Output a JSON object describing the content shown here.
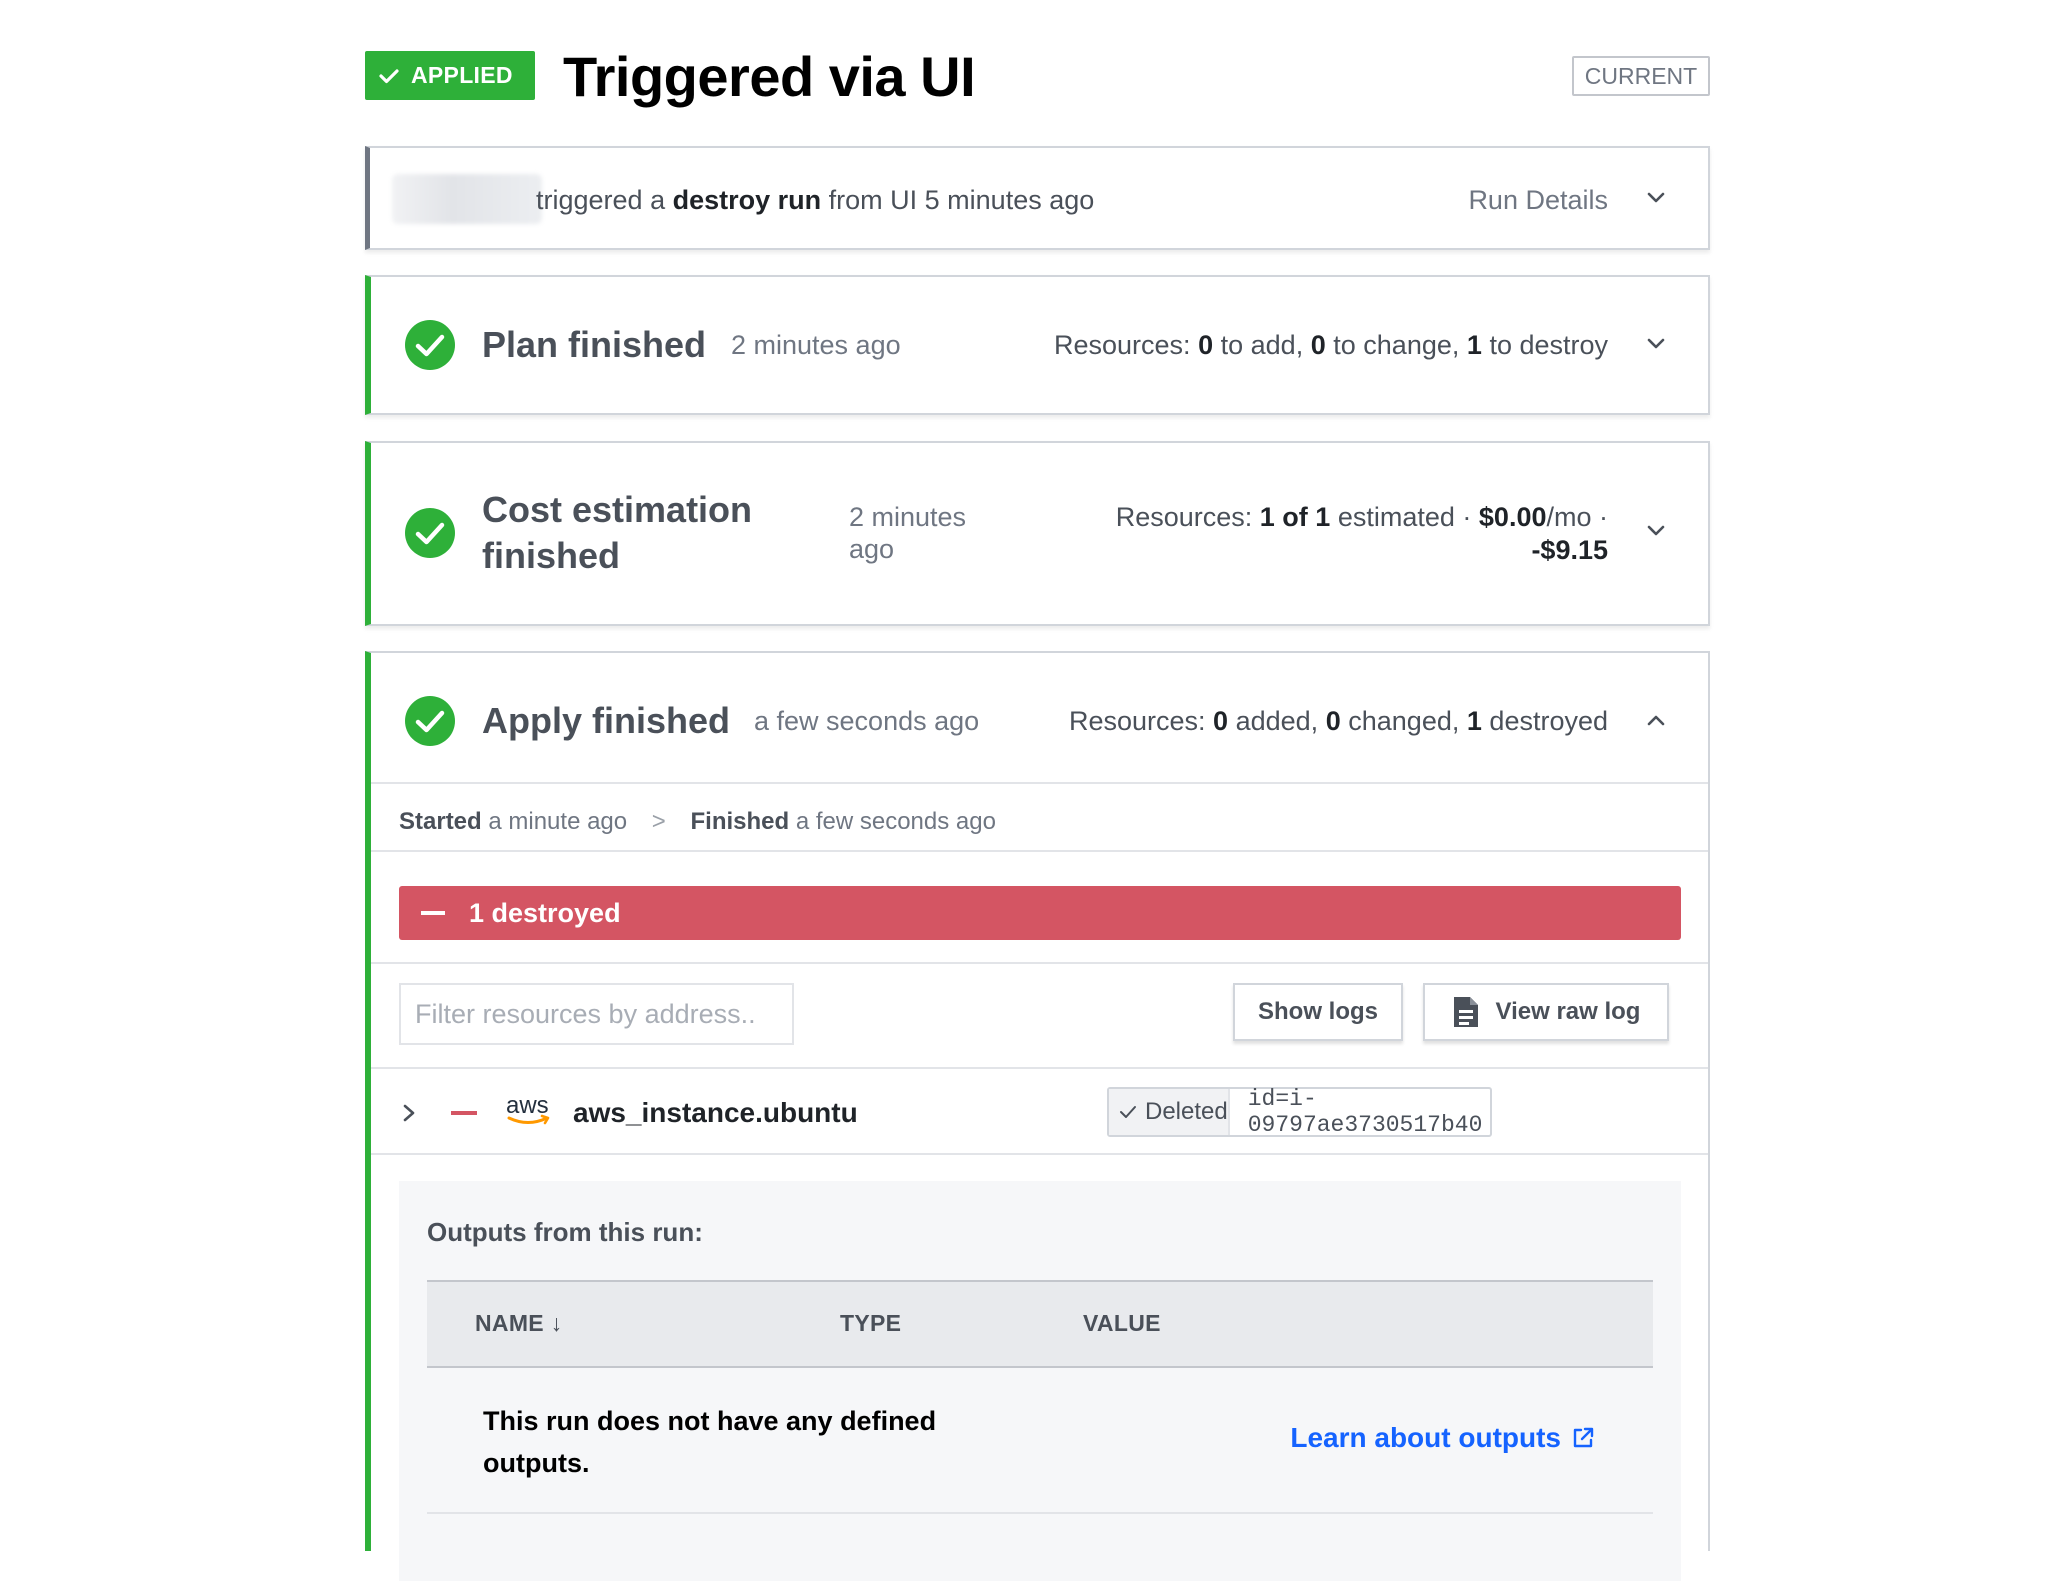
{
  "header": {
    "status_badge": "APPLIED",
    "title": "Triggered via UI",
    "current_tag": "CURRENT"
  },
  "trigger": {
    "text_pre": "triggered a",
    "run_type": "destroy run",
    "text_post": "from UI 5 minutes ago",
    "details_label": "Run Details"
  },
  "plan": {
    "title": "Plan finished",
    "time": "2 minutes ago",
    "res_label": "Resources:",
    "add_count": "0",
    "add_label": "to add,",
    "change_count": "0",
    "change_label": "to change,",
    "destroy_count": "1",
    "destroy_label": "to destroy"
  },
  "cost": {
    "title_line1": "Cost estimation",
    "title_line2": "finished",
    "time_line1": "2 minutes",
    "time_line2": "ago",
    "res_label": "Resources:",
    "estimated_count": "1 of 1",
    "estimated_label": "estimated ·",
    "monthly": "$0.00",
    "monthly_unit": "/mo ·",
    "delta": "-$9.15"
  },
  "apply": {
    "title": "Apply finished",
    "time": "a few seconds ago",
    "res_label": "Resources:",
    "added_count": "0",
    "added_label": "added,",
    "changed_count": "0",
    "changed_label": "changed,",
    "destroyed_count": "1",
    "destroyed_label": "destroyed",
    "started_label": "Started",
    "started_time": "a minute ago",
    "timeline_sep": ">",
    "finished_label": "Finished",
    "finished_time": "a few seconds ago",
    "destroyed_bar": "1 destroyed",
    "filter_placeholder": "Filter resources by address..",
    "show_logs": "Show logs",
    "view_raw_log": "View raw log",
    "resource": {
      "provider_logo": "aws",
      "name": "aws_instance.ubuntu",
      "status": "Deleted",
      "id": "id=i-09797ae3730517b40"
    },
    "outputs": {
      "title": "Outputs from this run:",
      "columns": [
        "NAME ↓",
        "TYPE",
        "VALUE"
      ],
      "empty_text": "This run does not have any defined outputs.",
      "learn_link": "Learn about outputs"
    }
  },
  "colors": {
    "success": "#2eb039",
    "danger": "#d45563",
    "link": "#1563ff",
    "aws_orange": "#ff9900"
  },
  "icons": [
    "check-icon",
    "chevron-down-icon",
    "chevron-up-icon",
    "chevron-right-icon",
    "document-icon",
    "external-link-icon"
  ]
}
